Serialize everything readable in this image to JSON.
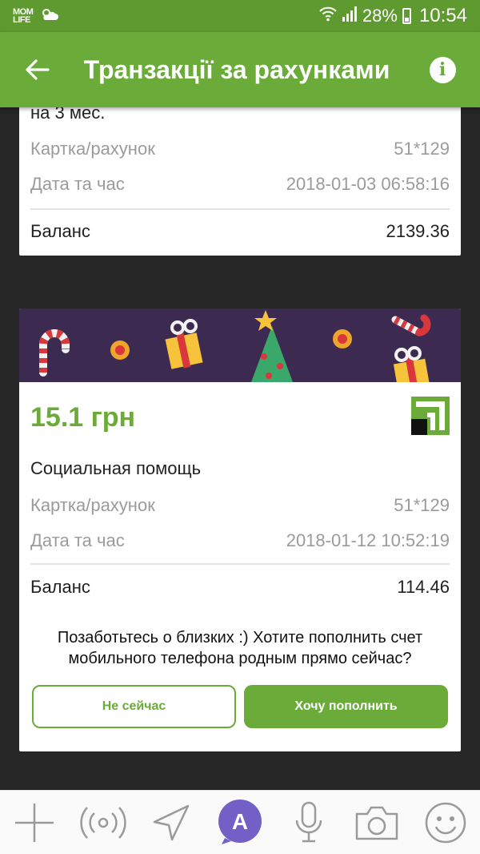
{
  "status_bar": {
    "carrier": "MOM\nLIFE",
    "battery": "28%",
    "time": "10:54"
  },
  "app_bar": {
    "title": "Транзакції за рахунками"
  },
  "transactions": [
    {
      "description": "на 3 мес.",
      "card_label": "Картка/рахунок",
      "card_value": "51*129",
      "datetime_label": "Дата та час",
      "datetime_value": "2018-01-03 06:58:16",
      "balance_label": "Баланс",
      "balance_value": "2139.36"
    },
    {
      "amount": "15.1 грн",
      "description": "Социальная помощь",
      "card_label": "Картка/рахунок",
      "card_value": "51*129",
      "datetime_label": "Дата та час",
      "datetime_value": "2018-01-12 10:52:19",
      "balance_label": "Баланс",
      "balance_value": "114.46",
      "promo_text": "Позаботьтесь о близких :) Хотите пополнить счет мобильного телефона родным прямо сейчас?",
      "button_secondary": "Не сейчас",
      "button_primary": "Хочу пополнить"
    }
  ],
  "bottom_toolbar": {
    "icons": [
      "plus-icon",
      "broadcast-icon",
      "location-arrow-icon",
      "sticker-a-icon",
      "microphone-icon",
      "camera-icon",
      "smiley-icon"
    ]
  },
  "colors": {
    "accent": "#6aab39",
    "status_bar": "#5e9a2f",
    "background": "#262626",
    "banner": "#3d2a51"
  }
}
